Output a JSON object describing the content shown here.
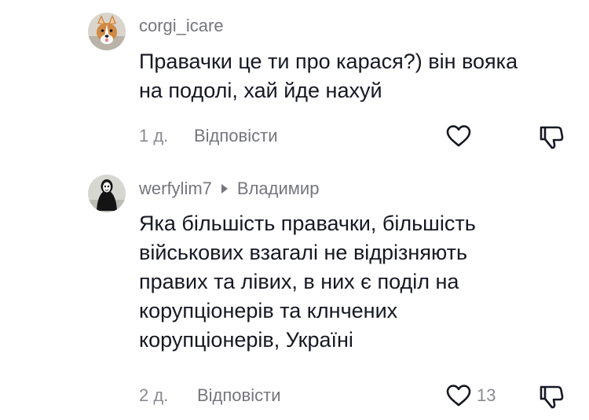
{
  "comments": [
    {
      "username": "corgi_icare",
      "reply_to": "",
      "avatar_icon": "corgi-dog-avatar",
      "text": "Правачки це ти про карася?) він вояка\nна подолі, хай йде нахуй",
      "time": "1 д.",
      "reply_label": "Відповісти",
      "like_count": "",
      "icons": {
        "like": "heart-outline-icon",
        "dislike": "thumb-down-outline-icon"
      }
    },
    {
      "username": "werfylim7",
      "reply_to": "Владимир",
      "avatar_icon": "masked-figure-avatar",
      "text": "Яка більшість правачки, більшість\nвійськових взагалі не відрізняють\nправих та лівих, в них є поділ на\nкорупціонерів та клнчених\nкорупціонерів, Україні",
      "time": "2 д.",
      "reply_label": "Відповісти",
      "like_count": "13",
      "icons": {
        "like": "heart-outline-icon",
        "dislike": "thumb-down-outline-icon"
      }
    }
  ],
  "colors": {
    "text": "#161823",
    "secondary": "#75767c",
    "meta": "#8a8b91",
    "background": "#ffffff"
  }
}
